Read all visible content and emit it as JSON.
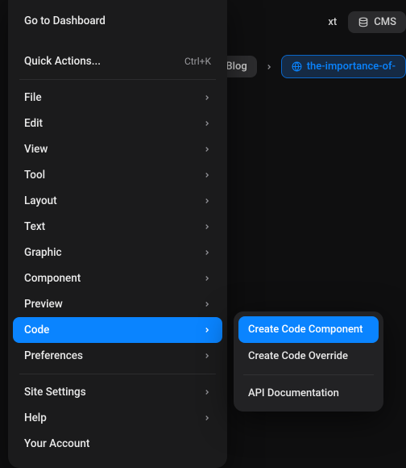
{
  "toolbar": {
    "text_btn": "xt",
    "cms_btn": "CMS"
  },
  "breadcrumb": {
    "blog": "Blog",
    "slug": "the-importance-of-"
  },
  "menu": {
    "dashboard": "Go to Dashboard",
    "quick_actions": "Quick Actions...",
    "quick_actions_shortcut": "Ctrl+K",
    "file": "File",
    "edit": "Edit",
    "view": "View",
    "tool": "Tool",
    "layout": "Layout",
    "text": "Text",
    "graphic": "Graphic",
    "component": "Component",
    "preview": "Preview",
    "code": "Code",
    "preferences": "Preferences",
    "site_settings": "Site Settings",
    "help": "Help",
    "account": "Your Account"
  },
  "submenu": {
    "create_component": "Create Code Component",
    "create_override": "Create Code Override",
    "api_docs": "API Documentation"
  }
}
